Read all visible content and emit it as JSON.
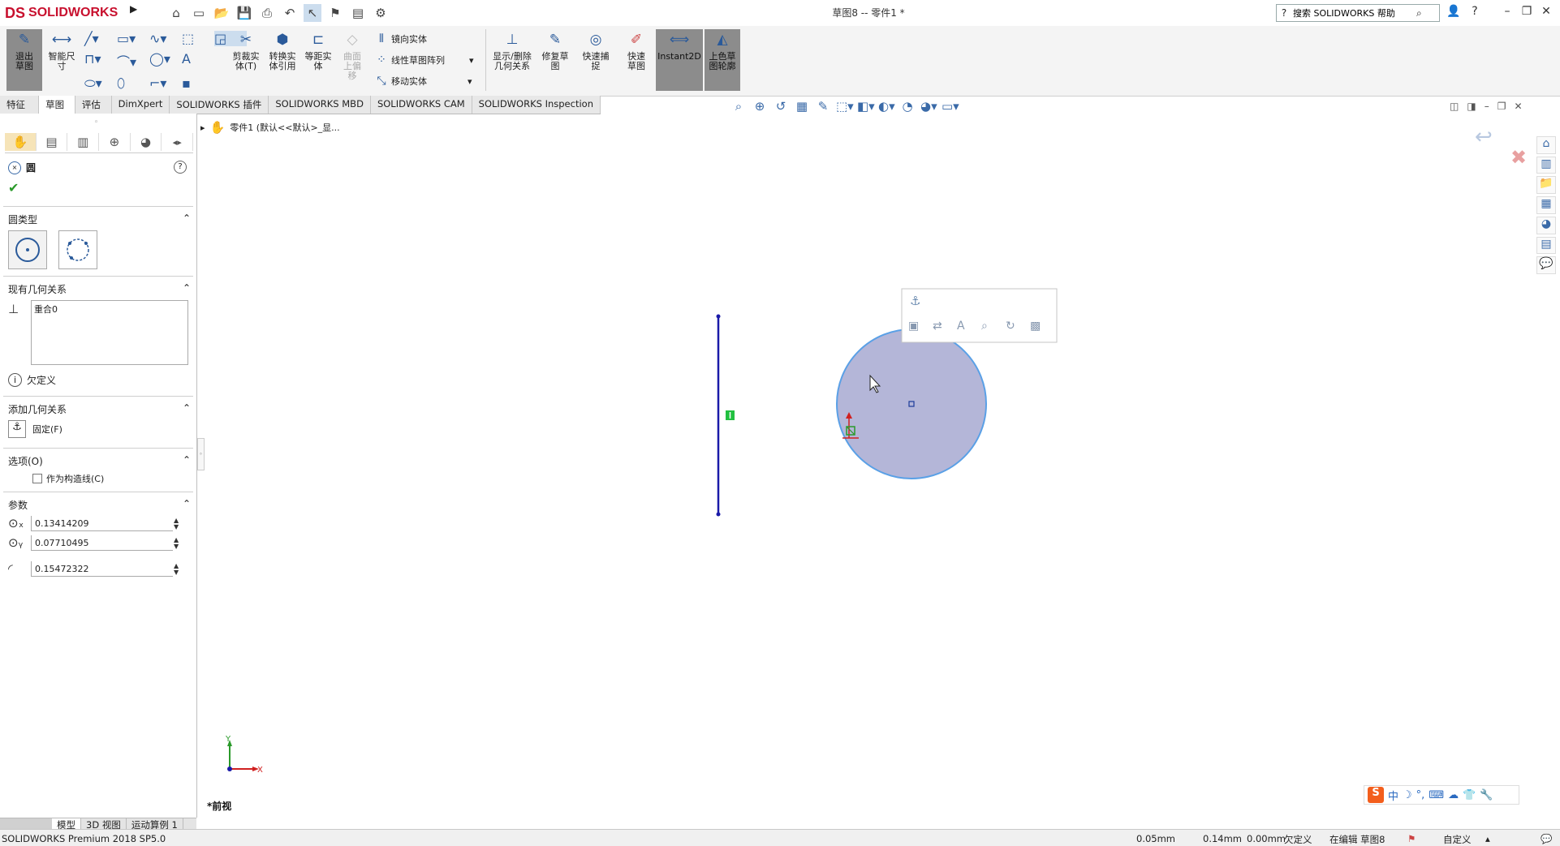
{
  "app": {
    "logo_text": "SOLIDWORKS",
    "logo_mark": "DS",
    "doc_title": "草图8 -- 零件1 *"
  },
  "search": {
    "value": "搜索 SOLIDWORKS 帮助"
  },
  "toolbar": {
    "exit_sketch": "退出草图",
    "smart_dim": "智能尺寸",
    "trim": "剪裁实体(T)",
    "convert": "转换实体引用",
    "offset": "等距实体",
    "surface_offset": "曲面上偏移",
    "mirror": "镜向实体",
    "linear_pattern": "线性草图阵列",
    "move": "移动实体",
    "display_relations": "显示/删除几何关系",
    "repair": "修复草图",
    "quick_snaps": "快速捕捉",
    "rapid_sketch": "快速草图",
    "instant2d": "Instant2D",
    "shaded_sketch": "上色草图轮廓"
  },
  "tabs": [
    "特征",
    "草图",
    "评估",
    "DimXpert",
    "SOLIDWORKS 插件",
    "SOLIDWORKS MBD",
    "SOLIDWORKS CAM",
    "SOLIDWORKS Inspection"
  ],
  "feature_tree": {
    "root": "零件1  (默认<<默认>_显..."
  },
  "property": {
    "title": "圆",
    "circle_type_header": "圆类型",
    "existing_relations_header": "现有几何关系",
    "relation_item": "重合0",
    "status": "欠定义",
    "add_relations_header": "添加几何关系",
    "fix": "固定(F)",
    "options_header": "选项(O)",
    "construction": "作为构造线(C)",
    "params_header": "参数",
    "cx": "0.13414209",
    "cy": "0.07710495",
    "radius": "0.15472322"
  },
  "view": {
    "label": "*前视",
    "axis_x": "X",
    "axis_y": "Y"
  },
  "bottom_tabs": [
    "模型",
    "3D 视图",
    "运动算例 1"
  ],
  "status": {
    "app": "SOLIDWORKS Premium 2018 SP5.0",
    "x": "0.05mm",
    "y": "0.14mm",
    "z": "0.00mm",
    "defined": "欠定义",
    "editing": "在编辑 草图8",
    "units": "自定义"
  },
  "ime": {
    "logo": "S",
    "mode": "中"
  },
  "colors": {
    "circle_fill": "#b4b6d8",
    "circle_stroke": "#5aa0e6",
    "line": "#1a1aa8",
    "accent": "#c8102e"
  }
}
